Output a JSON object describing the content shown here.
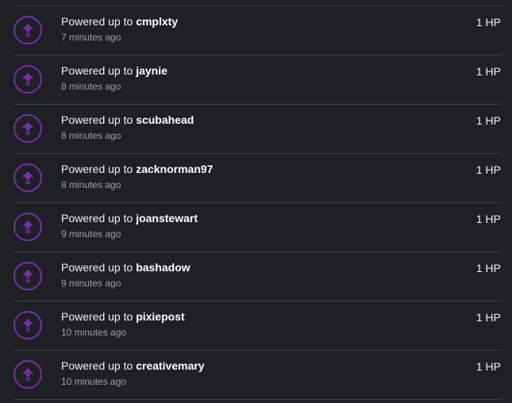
{
  "activity": {
    "items": [
      {
        "prefix": "Powered up to",
        "user": "cmplxty",
        "time": "7 minutes ago",
        "amount": "1 HP"
      },
      {
        "prefix": "Powered up to",
        "user": "jaynie",
        "time": "8 minutes ago",
        "amount": "1 HP"
      },
      {
        "prefix": "Powered up to",
        "user": "scubahead",
        "time": "8 minutes ago",
        "amount": "1 HP"
      },
      {
        "prefix": "Powered up to",
        "user": "zacknorman97",
        "time": "8 minutes ago",
        "amount": "1 HP"
      },
      {
        "prefix": "Powered up to",
        "user": "joanstewart",
        "time": "9 minutes ago",
        "amount": "1 HP"
      },
      {
        "prefix": "Powered up to",
        "user": "bashadow",
        "time": "9 minutes ago",
        "amount": "1 HP"
      },
      {
        "prefix": "Powered up to",
        "user": "pixiepost",
        "time": "10 minutes ago",
        "amount": "1 HP"
      },
      {
        "prefix": "Powered up to",
        "user": "creativemary",
        "time": "10 minutes ago",
        "amount": "1 HP"
      }
    ],
    "icon": "power-up-arrow-icon",
    "accent_color": "#7d2bb3"
  }
}
